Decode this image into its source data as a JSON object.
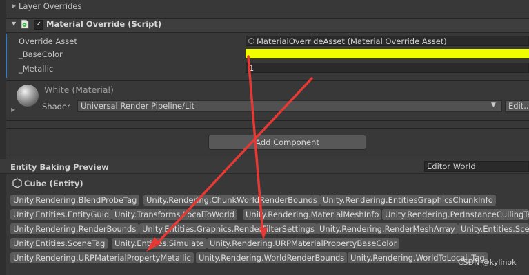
{
  "header": {
    "layer_overrides": "Layer Overrides"
  },
  "component": {
    "title": "Material Override (Script)",
    "enabled": true,
    "fields": {
      "override_asset_label": "Override Asset",
      "override_asset_value": "MaterialOverrideAsset (Material Override Asset)",
      "basecolor_label": "_BaseColor",
      "basecolor_color": "#f0ff00",
      "metallic_label": "_Metallic",
      "metallic_value": "1"
    }
  },
  "material": {
    "title": "White (Material)",
    "shader_label": "Shader",
    "shader_value": "Universal Render Pipeline/Lit",
    "edit_button": "Edit..."
  },
  "add_component": "Add Component",
  "baking_preview": {
    "title": "Entity Baking Preview",
    "world": "Editor World",
    "entity": "Cube (Entity)",
    "tag_rows": [
      [
        "Unity.Rendering.BlendProbeTag",
        "Unity.Rendering.ChunkWorldRenderBounds",
        "Unity.Rendering.EntitiesGraphicsChunkInfo"
      ],
      [
        "Unity.Entities.EntityGuid",
        "Unity.Transforms.LocalToWorld",
        "Unity.Rendering.MaterialMeshInfo",
        "Unity.Rendering.PerInstanceCullingTag"
      ],
      [
        "Unity.Rendering.RenderBounds",
        "Unity.Entities.Graphics.RenderFilterSettings",
        "Unity.Rendering.RenderMeshArray",
        "Unity.Entities.SceneSection"
      ],
      [
        "Unity.Entities.SceneTag",
        "Unity.Entities.Simulate",
        "Unity.Rendering.URPMaterialPropertyBaseColor"
      ],
      [
        "Unity.Rendering.URPMaterialPropertyMetallic",
        "Unity.Rendering.WorldRenderBounds",
        "Unity.Rendering.WorldToLocal_Tag"
      ]
    ]
  },
  "watermark": "CSDN @kylinok",
  "colors": {
    "annotation_arrow": "#e53935",
    "accent": "#3a79bb",
    "panel": "#383838",
    "tag": "#5b5b5b"
  }
}
